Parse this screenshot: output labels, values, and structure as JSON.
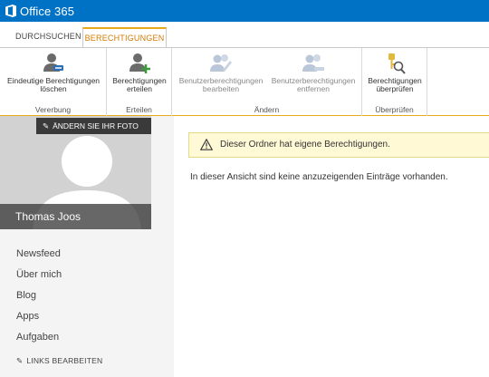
{
  "app": {
    "title": "Office 365",
    "accent": "#0072c6",
    "tab_accent": "#e8a91d"
  },
  "tabs": [
    {
      "label": "DURCHSUCHEN",
      "active": false
    },
    {
      "label": "BERECHTIGUNGEN",
      "active": true
    }
  ],
  "ribbon": {
    "groups": [
      {
        "label": "Vererbung",
        "buttons": [
          {
            "line1": "Eindeutige Berechtigungen",
            "line2": "löschen",
            "icon": "users-delete-icon",
            "enabled": true
          }
        ]
      },
      {
        "label": "Erteilen",
        "buttons": [
          {
            "line1": "Berechtigungen",
            "line2": "erteilen",
            "icon": "user-add-icon",
            "enabled": true
          }
        ]
      },
      {
        "label": "Ändern",
        "buttons": [
          {
            "line1": "Benutzerberechtigungen",
            "line2": "bearbeiten",
            "icon": "users-edit-icon",
            "enabled": false
          },
          {
            "line1": "Benutzerberechtigungen",
            "line2": "entfernen",
            "icon": "users-remove-icon",
            "enabled": false
          }
        ]
      },
      {
        "label": "Überprüfen",
        "buttons": [
          {
            "line1": "Berechtigungen",
            "line2": "überprüfen",
            "icon": "key-search-icon",
            "enabled": true
          }
        ]
      }
    ]
  },
  "profile": {
    "change_photo": "ÄNDERN SIE IHR FOTO",
    "name": "Thomas Joos"
  },
  "nav": {
    "items": [
      "Newsfeed",
      "Über mich",
      "Blog",
      "Apps",
      "Aufgaben"
    ],
    "edit_links": "LINKS BEARBEITEN"
  },
  "main": {
    "notice": "Dieser Ordner hat eigene Berechtigungen.",
    "empty_message": "In dieser Ansicht sind keine anzuzeigenden Einträge vorhanden."
  }
}
